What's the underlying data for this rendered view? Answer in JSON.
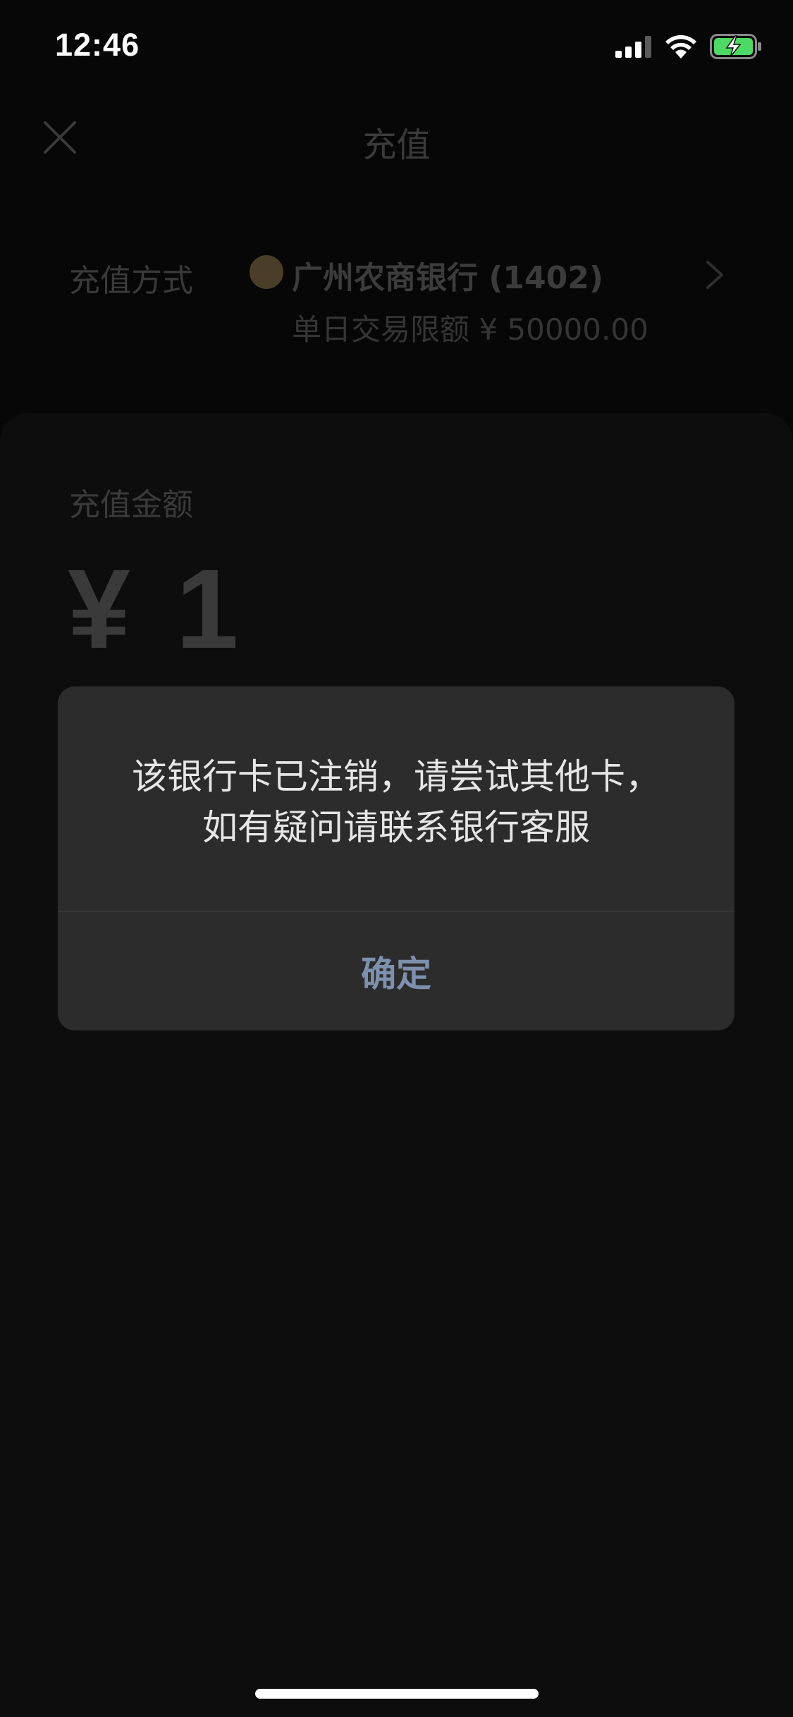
{
  "status_bar": {
    "time": "12:46",
    "icons": [
      "signal-icon",
      "wifi-icon",
      "battery-charging-icon"
    ]
  },
  "header": {
    "title": "充值",
    "close_icon": "close-icon"
  },
  "payment_method": {
    "label": "充值方式",
    "bank_name": "广州农商银行 (1402)",
    "limit_text": "单日交易限额 ¥ 50000.00"
  },
  "amount": {
    "label": "充值金额",
    "value": "¥ 1"
  },
  "dialog": {
    "message_line1": "该银行卡已注销，请尝试其他卡，",
    "message_line2": "如有疑问请联系银行客服",
    "confirm_label": "确定"
  },
  "colors": {
    "background": "#070707",
    "dialog_bg": "#2c2c2c",
    "confirm_text": "#7d90ad",
    "battery_green": "#4cd964"
  }
}
